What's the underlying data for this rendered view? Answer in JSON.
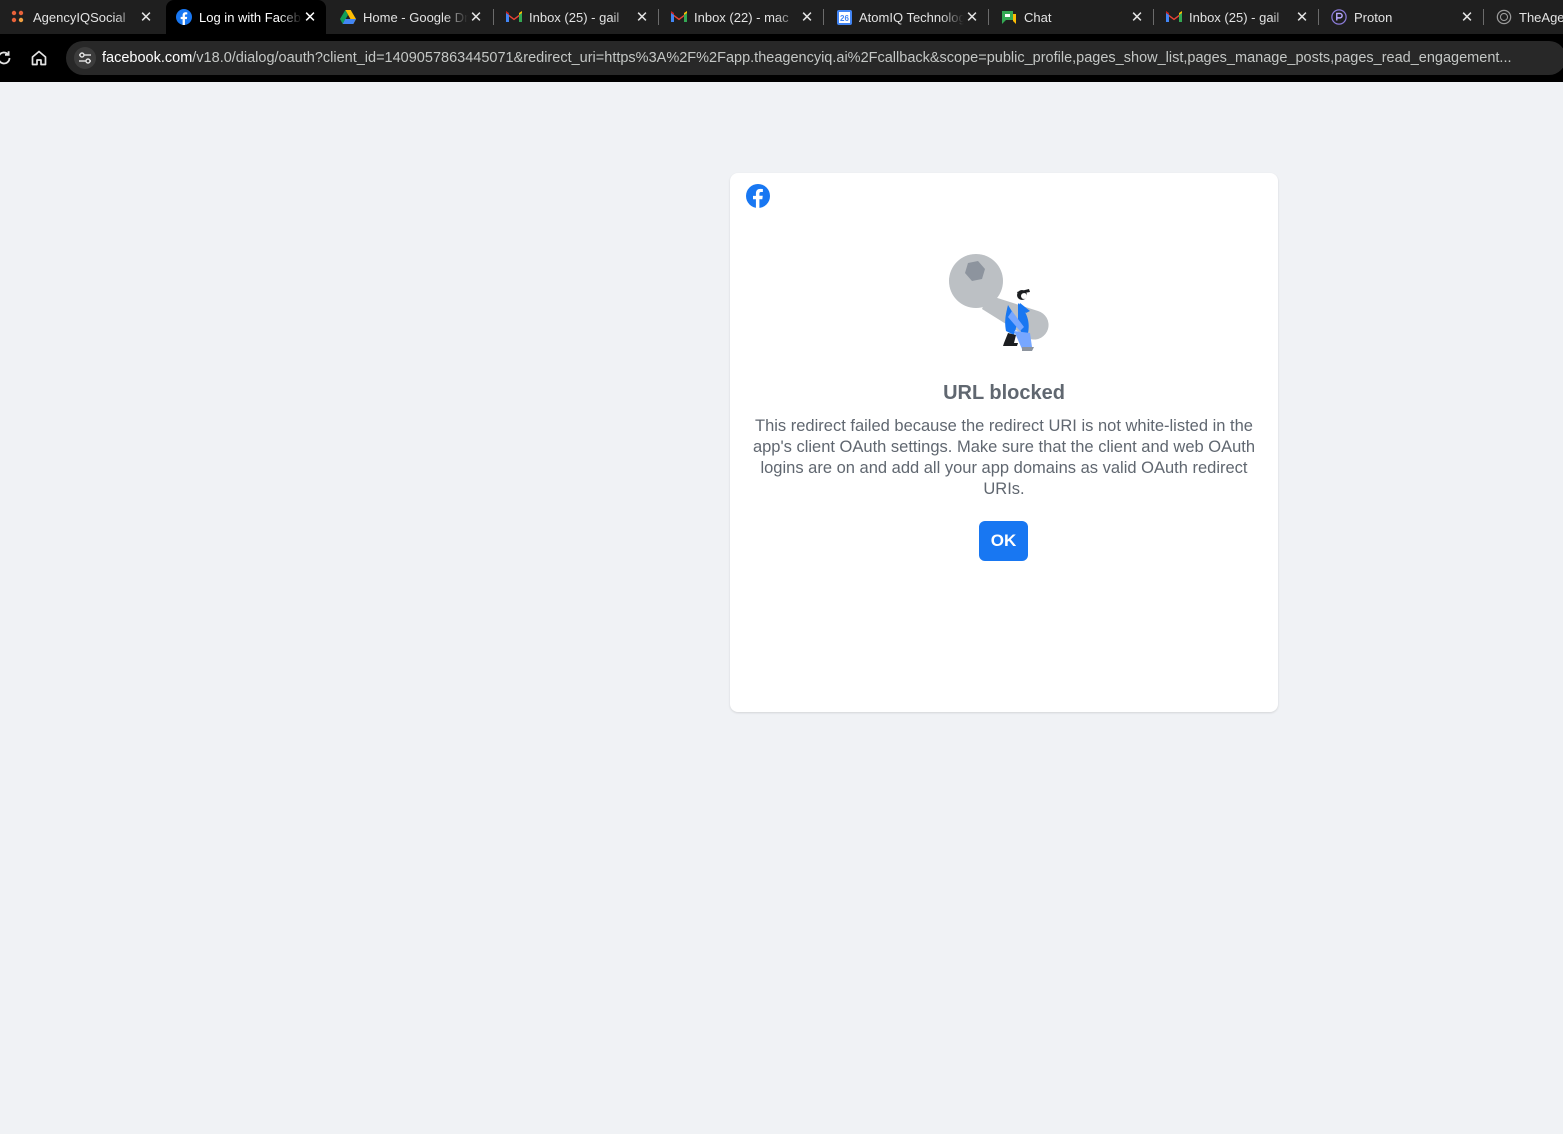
{
  "browser": {
    "tabs": [
      {
        "title": "AgencyIQSocial",
        "favicon": "agencyiq-favicon-icon",
        "active": false
      },
      {
        "title": "Log in with Facebook",
        "favicon": "facebook-favicon-icon",
        "active": true
      },
      {
        "title": "Home - Google Drive",
        "favicon": "google-drive-favicon-icon",
        "active": false
      },
      {
        "title": "Inbox (25) - gail",
        "favicon": "gmail-favicon-icon",
        "active": false
      },
      {
        "title": "Inbox (22) - mac",
        "favicon": "gmail-favicon-icon",
        "active": false
      },
      {
        "title": "AtomIQ Technologies",
        "favicon": "google-calendar-favicon-icon",
        "active": false
      },
      {
        "title": "Chat",
        "favicon": "google-chat-favicon-icon",
        "active": false
      },
      {
        "title": "Inbox (25) - gail",
        "favicon": "gmail-favicon-icon",
        "active": false
      },
      {
        "title": "Proton",
        "favicon": "proton-favicon-icon",
        "active": false
      },
      {
        "title": "TheAge",
        "favicon": "globe-favicon-icon",
        "active": false
      }
    ],
    "calendar_favicon_day": "26",
    "address": {
      "host": "facebook.com",
      "path": "/v18.0/dialog/oauth?client_id=1409057863445071&redirect_uri=https%3A%2F%2Fapp.theagencyiq.ai%2Fcallback&scope=public_profile,pages_show_list,pages_manage_posts,pages_read_engagement..."
    }
  },
  "dialog": {
    "title": "URL blocked",
    "message": "This redirect failed because the redirect URI is not white-listed in the app's client OAuth settings. Make sure that the client and web OAuth logins are on and add all your app domains as valid OAuth redirect URIs.",
    "ok_label": "OK"
  },
  "colors": {
    "page_background": "#f0f2f5",
    "facebook_blue": "#1877f2",
    "dialog_text": "#606770",
    "tabstrip": "#1f1f1f",
    "toolbar": "#000000"
  }
}
